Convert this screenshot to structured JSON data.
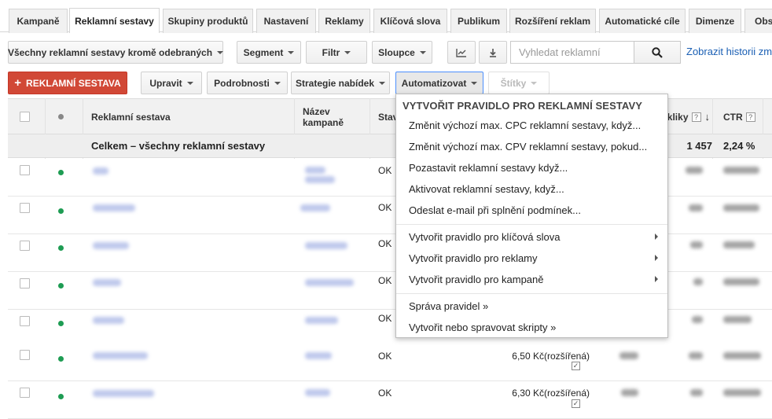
{
  "tabs": [
    {
      "label": "Kampaně"
    },
    {
      "label": "Reklamní sestavy"
    },
    {
      "label": "Skupiny produktů"
    },
    {
      "label": "Nastavení"
    },
    {
      "label": "Reklamy"
    },
    {
      "label": "Klíčová slova"
    },
    {
      "label": "Publikum"
    },
    {
      "label": "Rozšíření reklam"
    },
    {
      "label": "Automatické cíle"
    },
    {
      "label": "Dimenze"
    },
    {
      "label": "Obs"
    }
  ],
  "active_tab": "Reklamní sestavy",
  "toolbar": {
    "filter_view": "Všechny reklamní sestavy kromě odebraných",
    "segment": "Segment",
    "filter": "Filtr",
    "columns": "Sloupce",
    "search_placeholder": "Vyhledat reklamní",
    "history_link": "Zobrazit historii zm"
  },
  "actions": {
    "add_ad_group": "REKLAMNÍ SESTAVA",
    "edit": "Upravit",
    "details": "Podrobnosti",
    "bid_strategy": "Strategie nabídek",
    "automate": "Automatizovat",
    "labels": "Štítky"
  },
  "table": {
    "headers": {
      "ad_group": "Reklamní sestava",
      "campaign": "Název kampaně",
      "status": "Stav",
      "clicks": "Prokliky",
      "ctr": "CTR"
    },
    "total": {
      "label": "Celkem – všechny reklamní sestavy",
      "clicks": "1 457",
      "ctr": "2,24 %"
    },
    "rows": [
      {
        "status": "OK",
        "bid": ""
      },
      {
        "status": "OK",
        "bid": ""
      },
      {
        "status": "OK",
        "bid": ""
      },
      {
        "status": "OK",
        "bid": ""
      },
      {
        "status": "OK",
        "bid": ""
      },
      {
        "status": "OK",
        "bid": "6,50 Kč(rozšířená)"
      },
      {
        "status": "OK",
        "bid": "6,30 Kč(rozšířená)"
      }
    ]
  },
  "automate_menu": {
    "header": "VYTVOŘIT PRAVIDLO PRO REKLAMNÍ SESTAVY",
    "rule_items": [
      "Změnit výchozí max. CPC reklamní sestavy, když...",
      "Změnit výchozí max. CPV reklamní sestavy, pokud...",
      "Pozastavit reklamní sestavy když...",
      "Aktivovat reklamní sestavy, když...",
      "Odeslat e-mail při splnění podmínek..."
    ],
    "submenu_items": [
      "Vytvořit pravidlo pro klíčová slova",
      "Vytvořit pravidlo pro reklamy",
      "Vytvořit pravidlo pro kampaně"
    ],
    "manage_items": [
      "Správa pravidel »",
      "Vytvořit nebo spravovat skripty »"
    ]
  },
  "colors": {
    "primary_red": "#d14836",
    "status_green": "#1e9c53",
    "link_blue": "#1a5fb4"
  },
  "icons": {
    "chart_toggle": "line-chart-icon",
    "download": "download-icon",
    "search": "search-icon",
    "sort": "arrow-down-icon"
  }
}
